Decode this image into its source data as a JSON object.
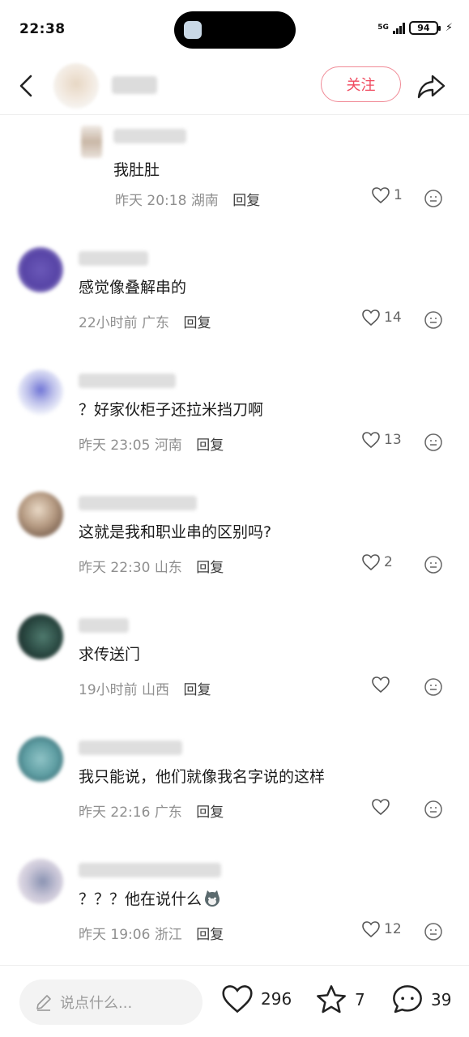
{
  "status": {
    "time": "22:38",
    "network": "5G",
    "battery": "94"
  },
  "header": {
    "follow_label": "关注"
  },
  "comments": [
    {
      "text": "我肚肚",
      "time": "昨天 20:18",
      "location": "湖南",
      "reply": "回复",
      "likes": "1"
    },
    {
      "text": "感觉像叠解串的",
      "time": "22小时前",
      "location": "广东",
      "reply": "回复",
      "likes": "14"
    },
    {
      "text": "？好家伙柜子还拉米挡刀啊",
      "time": "昨天 23:05",
      "location": "河南",
      "reply": "回复",
      "likes": "13"
    },
    {
      "text": "这就是我和职业串的区别吗?",
      "time": "昨天 22:30",
      "location": "山东",
      "reply": "回复",
      "likes": "2"
    },
    {
      "text": "求传送门",
      "time": "19小时前",
      "location": "山西",
      "reply": "回复",
      "likes": ""
    },
    {
      "text": "我只能说，他们就像我名字说的这样",
      "time": "昨天 22:16",
      "location": "广东",
      "reply": "回复",
      "likes": ""
    },
    {
      "text": "？？？他在说什么",
      "time": "昨天 19:06",
      "location": "浙江",
      "reply": "回复",
      "likes": "12"
    }
  ],
  "bottom": {
    "input_placeholder": "说点什么...",
    "like_count": "296",
    "star_count": "7",
    "comment_count": "39"
  },
  "colors": {
    "accent": "#f04a5f",
    "meta_gray": "#8f8f8f"
  },
  "icons": [
    "back-icon",
    "share-icon",
    "heart-icon",
    "emoji-icon",
    "pencil-icon",
    "star-icon",
    "comment-icon",
    "cat-emoji-icon"
  ]
}
